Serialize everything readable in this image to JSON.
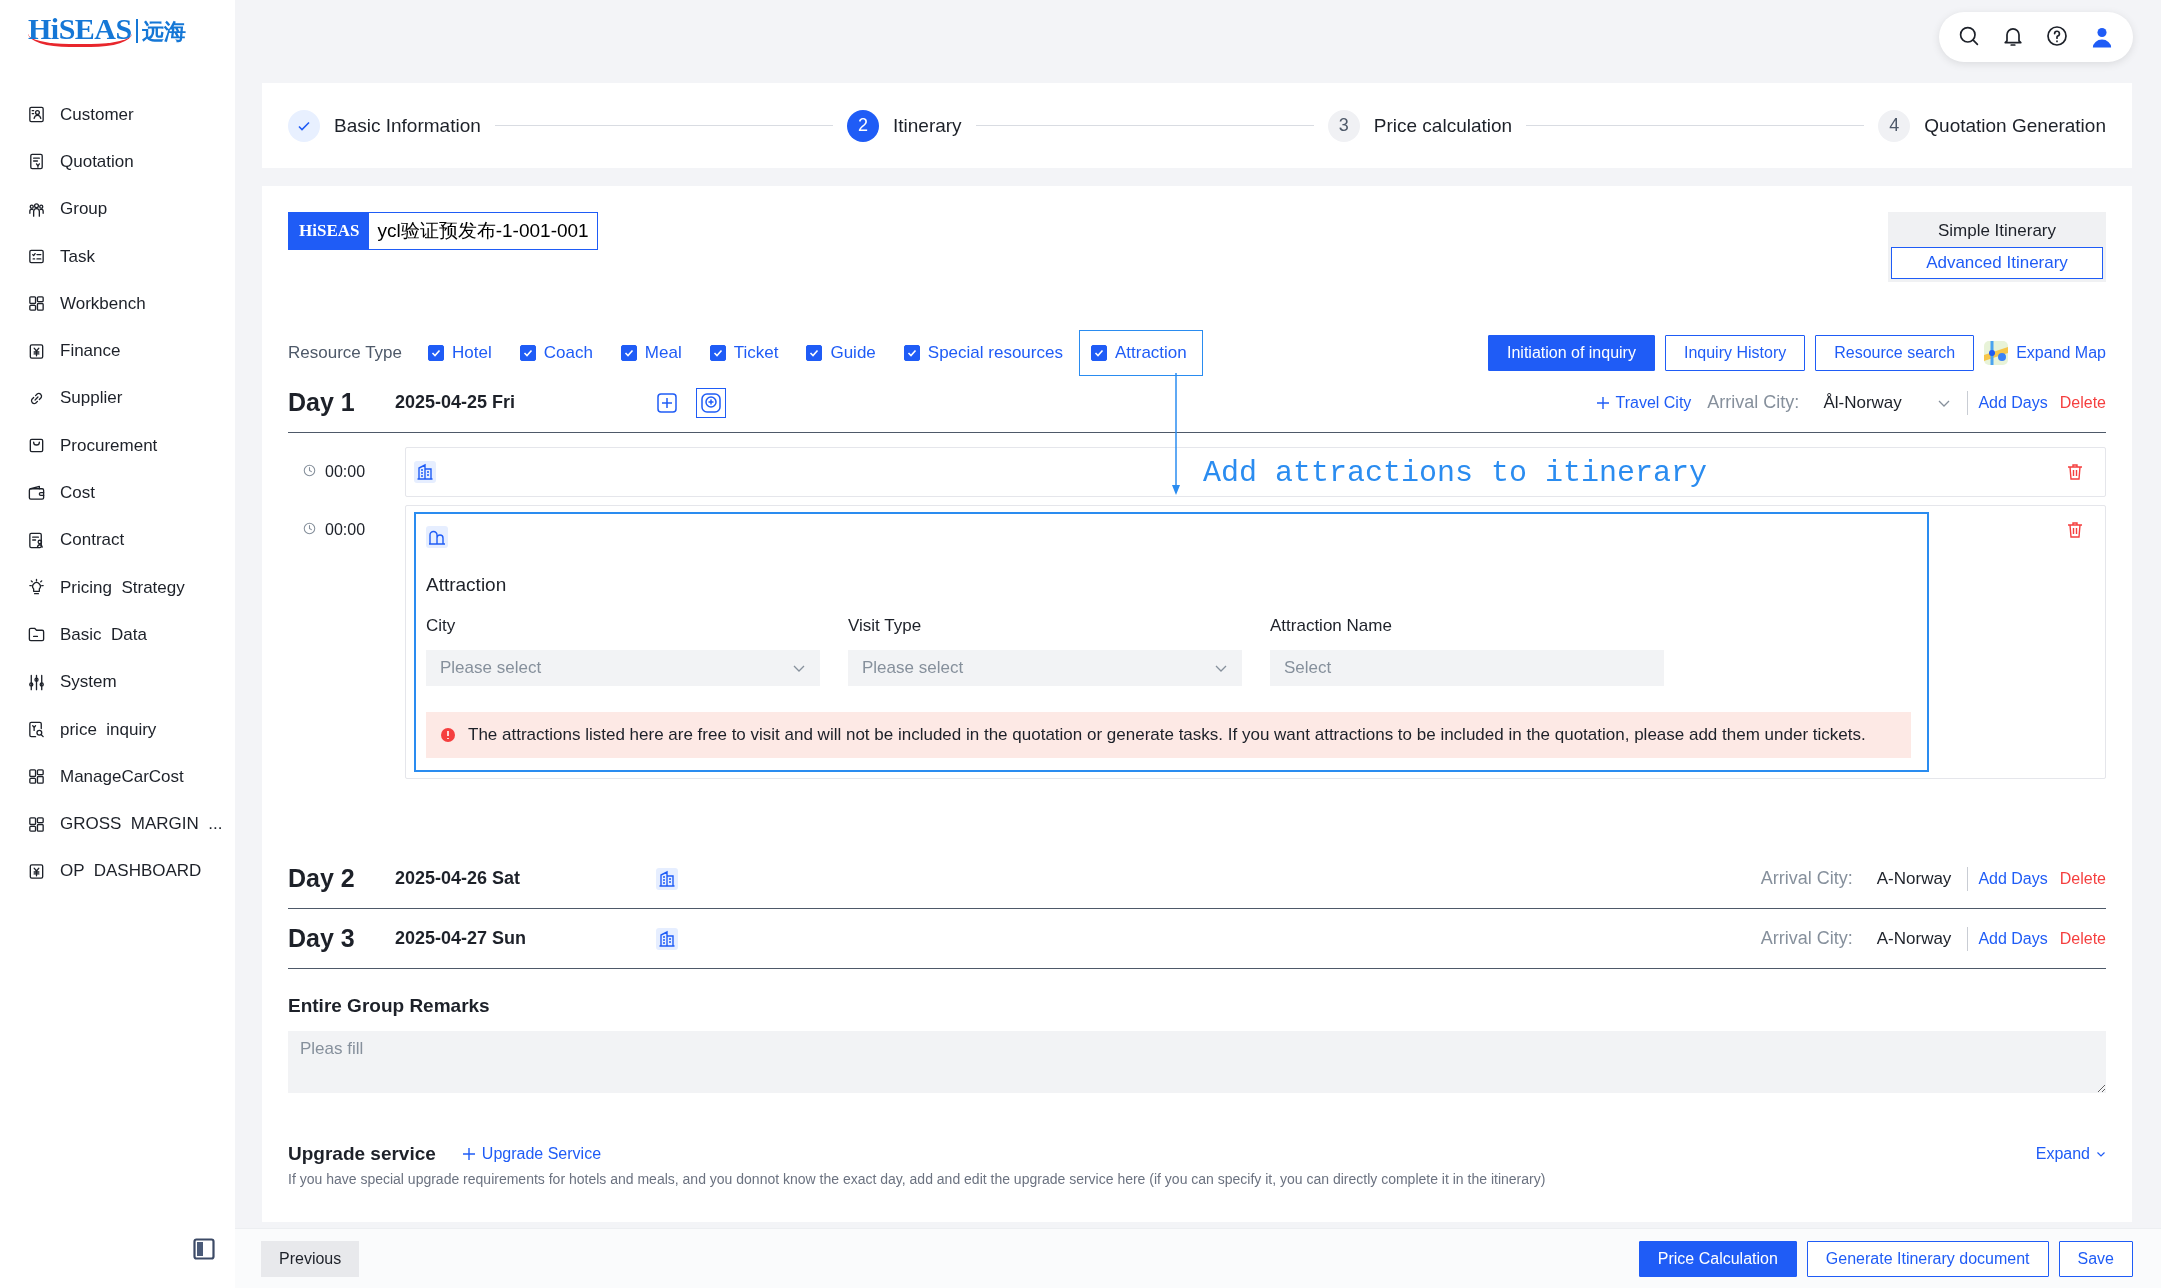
{
  "logo": {
    "brand": "HiSEAS",
    "cn": "远海"
  },
  "sidebar": {
    "items": [
      {
        "label": "Customer"
      },
      {
        "label": "Quotation"
      },
      {
        "label": "Group"
      },
      {
        "label": "Task"
      },
      {
        "label": "Workbench"
      },
      {
        "label": "Finance"
      },
      {
        "label": "Supplier"
      },
      {
        "label": "Procurement"
      },
      {
        "label": "Cost"
      },
      {
        "label": "Contract"
      },
      {
        "label": "Pricing  Strategy"
      },
      {
        "label": "Basic  Data"
      },
      {
        "label": "System"
      },
      {
        "label": "price  inquiry"
      },
      {
        "label": "ManageCarCost"
      },
      {
        "label": "GROSS  MARGIN  ..."
      },
      {
        "label": "OP  DASHBOARD"
      }
    ]
  },
  "steps": [
    {
      "label": "Basic Information",
      "completed": true,
      "selected": false
    },
    {
      "number": "2",
      "label": "Itinerary",
      "completed": false,
      "selected": true
    },
    {
      "number": "3",
      "label": "Price calculation",
      "completed": false,
      "selected": false
    },
    {
      "number": "4",
      "label": "Quotation Generation",
      "completed": false,
      "selected": false
    }
  ],
  "order": {
    "brand": "HiSEAS",
    "code": "ycl验证预发布-1-001-001"
  },
  "itinerary_mode": [
    {
      "label": "Simple Itinerary",
      "selected": false
    },
    {
      "label": "Advanced Itinerary",
      "selected": true
    }
  ],
  "resource_type": {
    "label": "Resource Type",
    "items": [
      {
        "label": "Hotel",
        "checked": true,
        "highlighted": false
      },
      {
        "label": "Coach",
        "checked": true,
        "highlighted": false
      },
      {
        "label": "Meal",
        "checked": true,
        "highlighted": false
      },
      {
        "label": "Ticket",
        "checked": true,
        "highlighted": false
      },
      {
        "label": "Guide",
        "checked": true,
        "highlighted": false
      },
      {
        "label": "Special resources",
        "checked": true,
        "highlighted": false
      },
      {
        "label": "Attraction",
        "checked": true,
        "highlighted": true
      }
    ]
  },
  "actions": [
    {
      "label": "Initiation of inquiry",
      "kind": "primary"
    },
    {
      "label": "Inquiry History",
      "kind": "outline"
    },
    {
      "label": "Resource search",
      "kind": "outline"
    },
    {
      "label": "Expand Map",
      "kind": "map-link"
    }
  ],
  "annotation": {
    "text": "Add attractions to itinerary"
  },
  "days": [
    {
      "label": "Day 1",
      "date": "2025-04-25 Fri",
      "icons": [
        {
          "kind": "add",
          "highlighted": false
        },
        {
          "kind": "add-circle",
          "highlighted": true
        }
      ],
      "travel_city": "Travel City",
      "arrival_label": "Arrival City:",
      "arrival_city": "Ål-Norway",
      "arrival_select": true,
      "add_days": "Add Days",
      "delete": "Delete",
      "entries": [
        {
          "time": "00:00",
          "kind": "hotel"
        },
        {
          "time": "00:00",
          "kind": "attraction",
          "title": "Attraction",
          "fields": [
            {
              "label": "City",
              "placeholder": "Please select",
              "kind": "select"
            },
            {
              "label": "Visit Type",
              "placeholder": "Please select",
              "kind": "select"
            },
            {
              "label": "Attraction Name",
              "placeholder": "Select",
              "kind": "input"
            }
          ],
          "notice": "The attractions listed here are free to visit and will not be included in the quotation or generate tasks. If you want attractions to be included in the quotation, please add them under tickets."
        }
      ]
    },
    {
      "label": "Day 2",
      "date": "2025-04-26 Sat",
      "icons": [
        {
          "kind": "hotel",
          "highlighted": false
        }
      ],
      "arrival_label": "Arrival City:",
      "arrival_city": "A-Norway",
      "arrival_select": false,
      "add_days": "Add Days",
      "delete": "Delete"
    },
    {
      "label": "Day 3",
      "date": "2025-04-27 Sun",
      "icons": [
        {
          "kind": "hotel",
          "highlighted": false
        }
      ],
      "arrival_label": "Arrival City:",
      "arrival_city": "A-Norway",
      "arrival_select": false,
      "add_days": "Add Days",
      "delete": "Delete"
    }
  ],
  "remarks": {
    "label": "Entire Group Remarks",
    "placeholder": "Pleas fill"
  },
  "upgrade": {
    "title": "Upgrade service",
    "add": "Upgrade Service",
    "expand": "Expand",
    "description": "If you have special upgrade requirements for hotels and meals, and you donnot know the exact day, add and edit the upgrade service here (if you can specify it, you can directly complete it in the itinerary)"
  },
  "footer": {
    "previous": "Previous",
    "buttons": [
      {
        "label": "Price Calculation",
        "kind": "primary"
      },
      {
        "label": "Generate Itinerary document",
        "kind": "outline"
      },
      {
        "label": "Save",
        "kind": "outline"
      }
    ]
  }
}
